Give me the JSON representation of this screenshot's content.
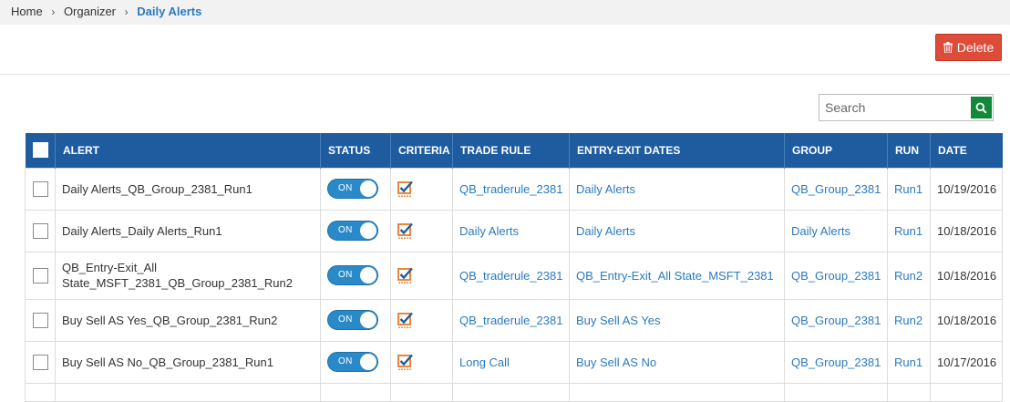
{
  "breadcrumb": {
    "items": [
      "Home",
      "Organizer"
    ],
    "current": "Daily Alerts"
  },
  "toolbar": {
    "delete_label": "Delete"
  },
  "search": {
    "placeholder": "Search",
    "value": ""
  },
  "colors": {
    "header_bg": "#1f5c9f",
    "link": "#2a7ac0",
    "delete_btn": "#dd4b39",
    "search_btn": "#13873a",
    "toggle_on": "#2a8ac9",
    "criteria_orange": "#e8782a"
  },
  "table": {
    "headers": {
      "alert": "ALERT",
      "status": "STATUS",
      "criteria": "CRITERIA",
      "trade_rule": "TRADE RULE",
      "entry_exit": "ENTRY-EXIT DATES",
      "group": "GROUP",
      "run": "RUN",
      "date": "DATE"
    },
    "rows": [
      {
        "alert": "Daily Alerts_QB_Group_2381_Run1",
        "status": "ON",
        "trade_rule": "QB_traderule_2381",
        "entry_exit": "Daily Alerts",
        "group": "QB_Group_2381",
        "run": "Run1",
        "date": "10/19/2016"
      },
      {
        "alert": "Daily Alerts_Daily Alerts_Run1",
        "status": "ON",
        "trade_rule": "Daily Alerts",
        "entry_exit": "Daily Alerts",
        "group": "Daily Alerts",
        "run": "Run1",
        "date": "10/18/2016"
      },
      {
        "alert": "QB_Entry-Exit_All State_MSFT_2381_QB_Group_2381_Run2",
        "status": "ON",
        "trade_rule": "QB_traderule_2381",
        "entry_exit": "QB_Entry-Exit_All State_MSFT_2381",
        "group": "QB_Group_2381",
        "run": "Run2",
        "date": "10/18/2016"
      },
      {
        "alert": "Buy Sell AS Yes_QB_Group_2381_Run2",
        "status": "ON",
        "trade_rule": "QB_traderule_2381",
        "entry_exit": "Buy Sell AS Yes",
        "group": "QB_Group_2381",
        "run": "Run2",
        "date": "10/18/2016"
      },
      {
        "alert": "Buy Sell AS No_QB_Group_2381_Run1",
        "status": "ON",
        "trade_rule": "Long Call",
        "entry_exit": "Buy Sell AS No",
        "group": "QB_Group_2381",
        "run": "Run1",
        "date": "10/17/2016"
      }
    ]
  }
}
